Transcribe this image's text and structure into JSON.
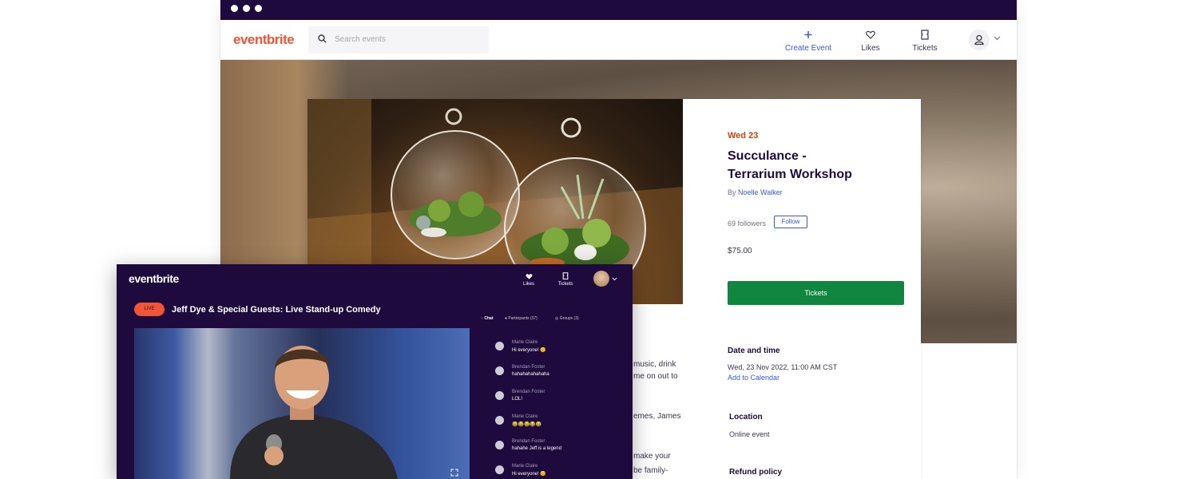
{
  "back_window": {
    "brand": "eventbrite",
    "search_placeholder": "Search events",
    "nav": {
      "create_event": "Create Event",
      "likes": "Likes",
      "tickets": "Tickets"
    },
    "event": {
      "date": "Wed 23",
      "title_line1": "Succulance -",
      "title_line2": "Terrarium Workshop",
      "by_prefix": "By",
      "organizer": "Noelle Walker",
      "followers": "69 followers",
      "follow_label": "Follow",
      "price": "$75.00",
      "tickets_label": "Tickets",
      "date_time_heading": "Date and time",
      "date_time_value": "Wed, 23 Nov 2022, 11:00 AM CST",
      "add_to_calendar": "Add to Calendar",
      "location_heading": "Location",
      "location_value": "Online event",
      "refund_heading": "Refund policy",
      "description_fragments": [
        "music, drink",
        "me on out to",
        "emes, James",
        "make your",
        "be family-"
      ]
    }
  },
  "front_window": {
    "brand": "eventbrite",
    "nav": {
      "likes": "Likes",
      "tickets": "Tickets"
    },
    "live_badge": "LIVE",
    "title": "Jeff Dye & Special Guests: Live Stand-up Comedy",
    "tabs": {
      "chat": "Chat",
      "participants": "Participants (37)",
      "groups": "Groups (3)"
    },
    "chat": [
      {
        "name": "Marie Claire",
        "message": "Hi everyone! 😊"
      },
      {
        "name": "Brendan Foster",
        "message": "hahahahahahaha"
      },
      {
        "name": "Brendan Foster",
        "message": "LOL!"
      },
      {
        "name": "Marie Claire",
        "message": "😂😂😂😂😂"
      },
      {
        "name": "Brendan Foster",
        "message": "hahahe Jeff is a legend"
      },
      {
        "name": "Marie Claire",
        "message": "Hi everyone! 😊"
      }
    ]
  },
  "colors": {
    "brand_orange": "#f05537",
    "deep_purple": "#1e0a3c",
    "link_blue": "#3659e3",
    "ticket_green": "#118640",
    "date_orange": "#d1410c"
  },
  "icons": [
    "search-icon",
    "plus-icon",
    "heart-icon",
    "ticket-icon",
    "user-icon",
    "chevron-down-icon",
    "chat-icon",
    "participants-icon",
    "groups-icon",
    "fullscreen-icon"
  ]
}
